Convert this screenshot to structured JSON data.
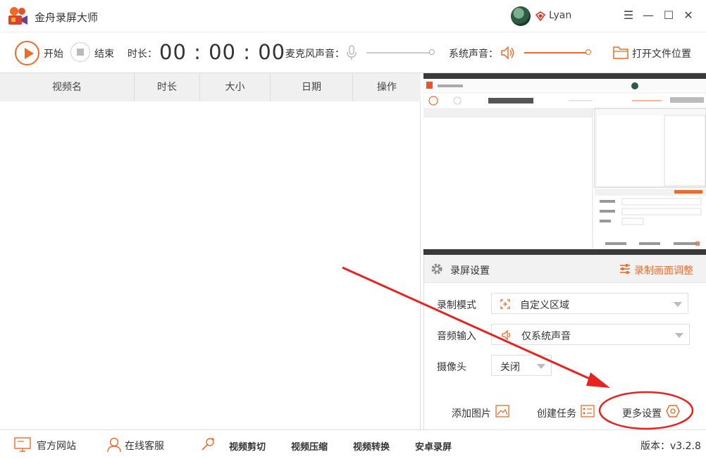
{
  "titlebar": {
    "app_title": "金舟录屏大师",
    "username": "Lyan",
    "minimize": "—",
    "maximize": "☐",
    "close": "✕",
    "menu": "☰"
  },
  "toolbar": {
    "start_label": "开始",
    "stop_label": "结束",
    "duration_label": "时长：",
    "timer": "00 : 00 : 00",
    "mic_label": "麦克风声音：",
    "system_label": "系统声音：",
    "open_folder_label": "打开文件位置",
    "mic_volume": 0,
    "system_volume": 1.0
  },
  "list": {
    "columns": [
      "视频名",
      "时长",
      "大小",
      "日期",
      "操作"
    ]
  },
  "settings": {
    "title": "录屏设置",
    "adjust_label": "录制画面调整",
    "mode_label": "录制模式",
    "mode_value": "自定义区域",
    "audio_label": "音频输入",
    "audio_value": "仅系统声音",
    "camera_label": "摄像头",
    "camera_value": "关闭",
    "add_image": "添加图片",
    "create_task": "创建任务",
    "more_settings": "更多设置"
  },
  "statusbar": {
    "website": "官方网站",
    "support": "在线客服",
    "video_cut": "视频剪切",
    "video_compress": "视频压缩",
    "video_convert": "视频转换",
    "android_record": "安卓录屏",
    "version": "版本：v3.2.8"
  },
  "colors": {
    "accent": "#f06a27",
    "annotation": "#e8231f"
  }
}
